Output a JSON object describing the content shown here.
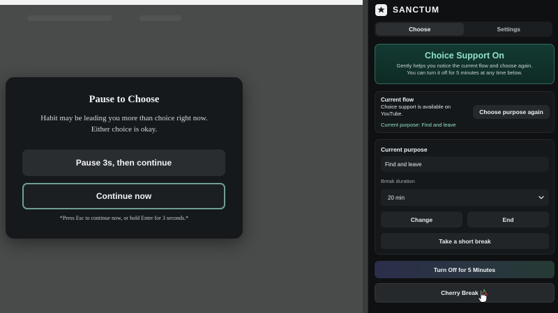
{
  "modal": {
    "title": "Pause to Choose",
    "line1": "Habit may be leading you more than choice right now.",
    "line2": "Either choice is okay.",
    "pause_button": "Pause 3s, then continue",
    "continue_button": "Continue now",
    "hint": "*Press Esc to continue now, or hold Enter for 3 seconds.*"
  },
  "sidebar": {
    "brand": "SANCTUM",
    "tabs": [
      {
        "label": "Choose",
        "active": true
      },
      {
        "label": "Settings",
        "active": false
      }
    ],
    "support": {
      "title": "Choice Support On",
      "desc_line1": "Gently helps you notice the current flow and choose again.",
      "desc_line2": "You can turn it off for 5 minutes at any time below."
    },
    "flow": {
      "title": "Current flow",
      "status": "Choice support is available on YouTube.",
      "purpose": "Current purpose: Find and leave",
      "choose_button": "Choose purpose again"
    },
    "purpose": {
      "title": "Current purpose",
      "input_value": "Find and leave",
      "break_label": "Break duration",
      "break_value": "20 min",
      "change_button": "Change",
      "end_button": "End",
      "short_break_button": "Take a short break"
    },
    "turn_off_button": "Turn Off for 5 Minutes",
    "cherry_button": "Cherry Break"
  },
  "colors": {
    "accent": "#8fe0c6",
    "continue_border": "#6f9f96",
    "sidebar_bg": "#0e1012"
  },
  "icons": [
    "brand-logo-icon",
    "chevron-down-icon",
    "cherry-icon",
    "hand-cursor-icon"
  ]
}
